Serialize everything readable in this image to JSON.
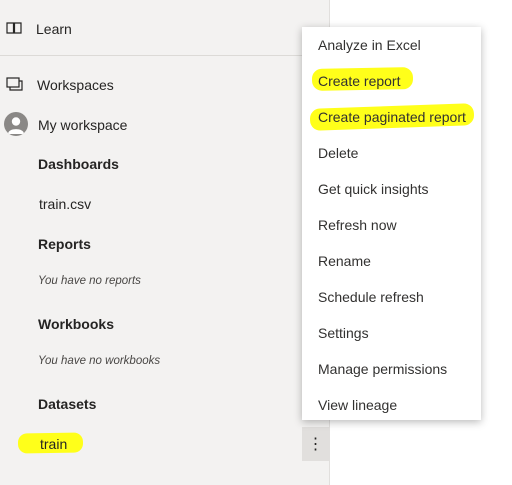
{
  "sidebar": {
    "learn": {
      "label": "Learn",
      "icon": "book-icon"
    },
    "workspaces": {
      "label": "Workspaces",
      "icon": "workspaces-icon"
    },
    "my_workspace": {
      "label": "My workspace",
      "icon": "user-avatar-icon"
    },
    "sections": [
      {
        "title": "Dashboards",
        "items": [
          "train.csv"
        ],
        "empty": ""
      },
      {
        "title": "Reports",
        "items": [],
        "empty": "You have no reports"
      },
      {
        "title": "Workbooks",
        "items": [],
        "empty": "You have no workbooks"
      },
      {
        "title": "Datasets",
        "items": [
          "train"
        ],
        "empty": ""
      }
    ],
    "more_button": {
      "icon": "more-options-icon",
      "glyph": "⋮"
    }
  },
  "context_menu": {
    "items": [
      "Analyze in Excel",
      "Create report",
      "Create paginated report",
      "Delete",
      "Get quick insights",
      "Refresh now",
      "Rename",
      "Schedule refresh",
      "Settings",
      "Manage permissions",
      "View lineage"
    ]
  },
  "colors": {
    "highlight": "#ffff1a",
    "sidebar_bg": "#f3f2f1",
    "menu_bg": "#ffffff"
  }
}
